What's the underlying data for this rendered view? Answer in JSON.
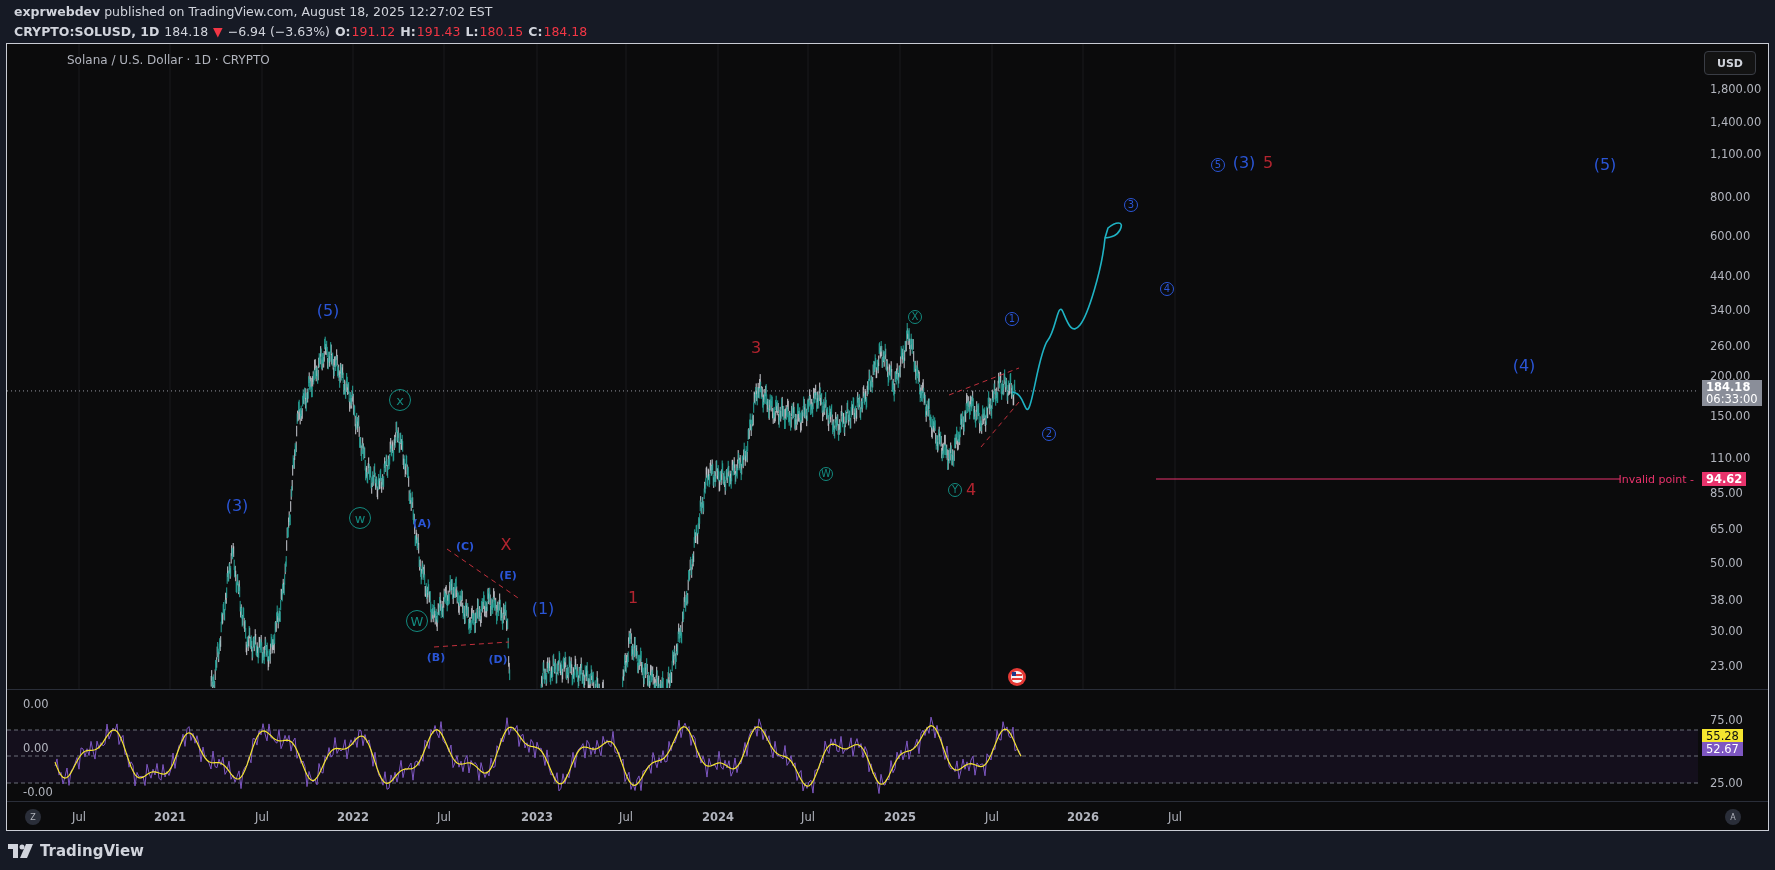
{
  "header": {
    "byline": "**exprwebdev** published on TradingView.com, August 18, 2025 12:27:02 EST"
  },
  "quote": {
    "symbol": "CRYPTO:SOLUSD, 1D",
    "price": "184.18",
    "arrow": "▼",
    "change": "−6.94 (−3.63%)",
    "ohlc": [
      {
        "label": "O:",
        "value": "191.12"
      },
      {
        "label": "H:",
        "value": "191.43"
      },
      {
        "label": "L:",
        "value": "180.15"
      },
      {
        "label": "C:",
        "value": "184.18"
      }
    ]
  },
  "chart": {
    "legend": "Solana / U.S. Dollar · 1D · CRYPTO",
    "currency_button": "USD",
    "price_axis": [
      "1,800.00",
      "1,400.00",
      "1,100.00",
      "800.00",
      "600.00",
      "440.00",
      "340.00",
      "260.00",
      "200.00",
      "150.00",
      "110.00",
      "85.00",
      "65.00",
      "50.00",
      "38.00",
      "30.00",
      "23.00"
    ],
    "last_price": {
      "value": "184.18",
      "countdown": "06:33:00"
    },
    "invalid_level": {
      "label": "Invalid point -",
      "value": "94.62"
    },
    "wave_labels": [
      {
        "text": "(3)",
        "kind": "wave",
        "color": "#2a55d6"
      },
      {
        "text": "(5)",
        "kind": "wave",
        "color": "#2a55d6"
      },
      {
        "text": "x",
        "kind": "bigcircle",
        "color": "#138a7f"
      },
      {
        "text": "w",
        "kind": "bigcircle",
        "color": "#138a7f"
      },
      {
        "text": "(A)",
        "kind": "sub",
        "color": "#2a55d6"
      },
      {
        "text": "(C)",
        "kind": "sub",
        "color": "#2a55d6"
      },
      {
        "text": "X",
        "kind": "wave",
        "color": "#b2242f"
      },
      {
        "text": "(E)",
        "kind": "sub",
        "color": "#2a55d6"
      },
      {
        "text": "W",
        "kind": "bigcircle",
        "color": "#138a7f"
      },
      {
        "text": "(1)",
        "kind": "wave",
        "color": "#2a55d6"
      },
      {
        "text": "(B)",
        "kind": "sub",
        "color": "#2a55d6"
      },
      {
        "text": "(D)",
        "kind": "sub",
        "color": "#2a55d6"
      },
      {
        "text": "1",
        "kind": "wave",
        "color": "#b2242f"
      },
      {
        "text": "3",
        "kind": "wave",
        "color": "#b2242f"
      },
      {
        "text": "W",
        "kind": "circled",
        "color": "#138a7f"
      },
      {
        "text": "X",
        "kind": "circled",
        "color": "#138a7f"
      },
      {
        "text": "Y",
        "kind": "circled",
        "color": "#138a7f"
      },
      {
        "text": "4",
        "kind": "wave",
        "color": "#b2242f"
      },
      {
        "text": "1",
        "kind": "circled",
        "color": "#2a55d6"
      },
      {
        "text": "2",
        "kind": "circled",
        "color": "#2a55d6"
      },
      {
        "text": "3",
        "kind": "circled",
        "color": "#2a55d6"
      },
      {
        "text": "4",
        "kind": "circled",
        "color": "#2a55d6"
      },
      {
        "text": "5",
        "kind": "circled",
        "color": "#2a55d6"
      },
      {
        "text": "(3)",
        "kind": "wave",
        "color": "#2a55d6"
      },
      {
        "text": "5",
        "kind": "wave",
        "color": "#b2242f"
      },
      {
        "text": "(5)",
        "kind": "wave",
        "color": "#2a55d6"
      },
      {
        "text": "(4)",
        "kind": "wave",
        "color": "#2a55d6"
      }
    ]
  },
  "oscillator": {
    "left_axis": [
      "0.00",
      "0.00",
      "-0.00"
    ],
    "right_axis": [
      "75.00",
      "25.00"
    ],
    "values": [
      {
        "value": "55.28",
        "color": "#f5e62f"
      },
      {
        "value": "52.67",
        "color": "#7e57c2"
      }
    ]
  },
  "time_axis": {
    "z_button": "Z",
    "labels": [
      "Jul",
      "2021",
      "Jul",
      "2022",
      "Jul",
      "2023",
      "Jul",
      "2024",
      "Jul",
      "2025",
      "Jul",
      "2026",
      "Jul"
    ],
    "a_button": "A"
  },
  "footer": {
    "brand": "TradingView"
  }
}
